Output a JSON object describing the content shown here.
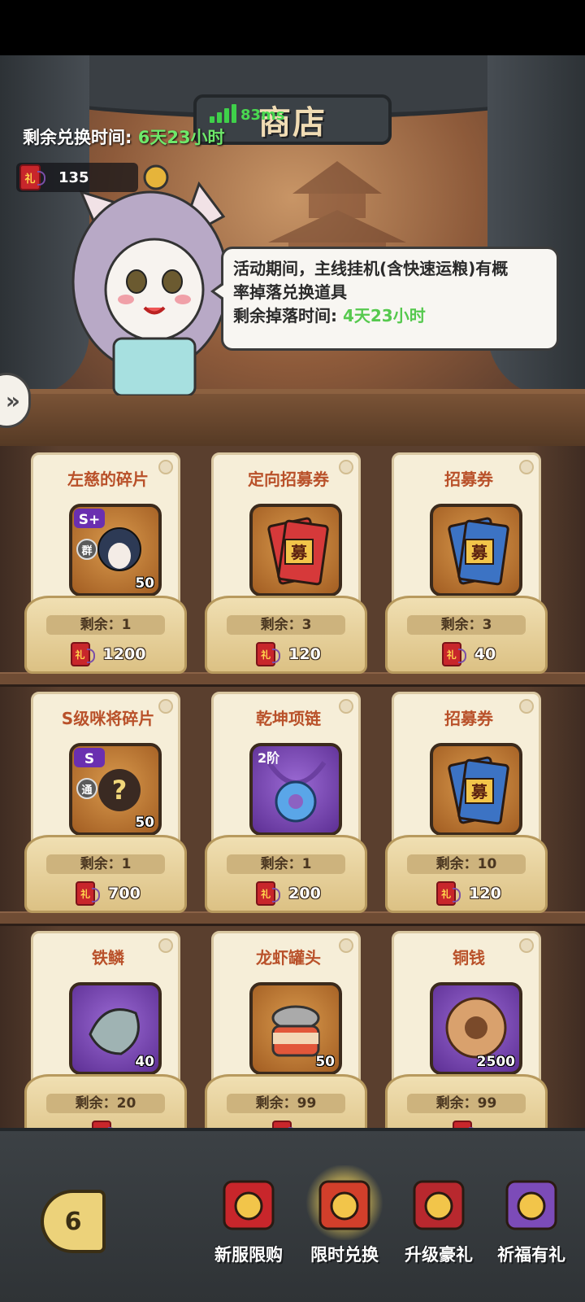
{
  "header": {
    "title": "商店",
    "ping": "83ms",
    "timer_label": "剩余兑换时间: ",
    "timer_value": "6天23小时",
    "currency_amount": "135",
    "currency_icon": "hongbao-icon",
    "hongbao_char": "礼"
  },
  "npc": {
    "bubble_line1": "活动期间，主线挂机(含快速运粮)有概",
    "bubble_line2": "率掉落兑换道具",
    "bubble_line3_label": "剩余掉落时间: ",
    "bubble_line3_value": "4天23小时"
  },
  "items": [
    {
      "name": "左慈的碎片",
      "count": "50",
      "remain": "剩余：1",
      "price": "1200",
      "icon": "hero-shard-icon",
      "grade": "S+",
      "faction": "群"
    },
    {
      "name": "定向招募券",
      "count": "",
      "remain": "剩余：3",
      "price": "120",
      "icon": "red-recruit-ticket-icon",
      "ticket_char": "募"
    },
    {
      "name": "招募券",
      "count": "",
      "remain": "剩余：3",
      "price": "40",
      "icon": "blue-recruit-ticket-icon",
      "ticket_char": "募"
    },
    {
      "name": "S级咪将碎片",
      "count": "50",
      "remain": "剩余：1",
      "price": "700",
      "icon": "mystery-shard-icon",
      "grade": "S",
      "faction": "通"
    },
    {
      "name": "乾坤项链",
      "count": "",
      "remain": "剩余：1",
      "price": "200",
      "icon": "necklace-icon",
      "tier": "2阶"
    },
    {
      "name": "招募券",
      "count": "",
      "remain": "剩余：10",
      "price": "120",
      "icon": "blue-recruit-ticket-icon",
      "ticket_char": "募"
    },
    {
      "name": "铁鳞",
      "count": "40",
      "remain": "剩余：20",
      "price": "",
      "icon": "iron-scale-icon"
    },
    {
      "name": "龙虾罐头",
      "count": "50",
      "remain": "剩余：99",
      "price": "",
      "icon": "lobster-can-icon"
    },
    {
      "name": "铜钱",
      "count": "2500",
      "remain": "剩余：99",
      "price": "",
      "icon": "copper-coin-icon"
    }
  ],
  "tabs": [
    {
      "label": "新服限购",
      "icon": "gift-box-icon",
      "active": false
    },
    {
      "label": "限时兑换",
      "icon": "scroll-exchange-icon",
      "active": true
    },
    {
      "label": "升级豪礼",
      "icon": "upgrade-gift-icon",
      "active": false
    },
    {
      "label": "祈福有礼",
      "icon": "blessing-coin-icon",
      "active": false
    }
  ],
  "back_glyph": "6",
  "colors": {
    "accent_green": "#56c94e",
    "title_orange": "#b9512a",
    "hongbao_red": "#c8262b"
  }
}
